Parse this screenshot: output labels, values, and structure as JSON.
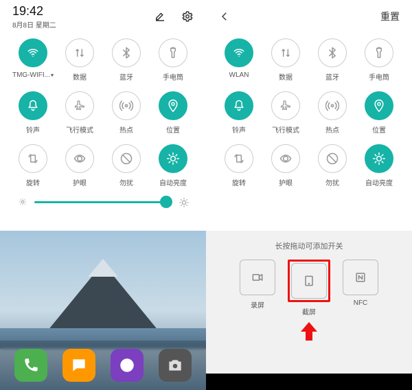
{
  "left": {
    "time": "19:42",
    "date": "8月8日 星期二",
    "tiles": [
      {
        "name": "wifi",
        "label": "TMG-WIFI...",
        "active": true,
        "caret": true
      },
      {
        "name": "data",
        "label": "数据",
        "active": false,
        "caret": false
      },
      {
        "name": "bluetooth",
        "label": "蓝牙",
        "active": false,
        "caret": false
      },
      {
        "name": "flashlight",
        "label": "手电筒",
        "active": false,
        "caret": false
      },
      {
        "name": "ring",
        "label": "铃声",
        "active": true,
        "caret": false
      },
      {
        "name": "airplane",
        "label": "飞行模式",
        "active": false,
        "caret": false
      },
      {
        "name": "hotspot",
        "label": "热点",
        "active": false,
        "caret": false
      },
      {
        "name": "location",
        "label": "位置",
        "active": true,
        "caret": false
      },
      {
        "name": "rotate",
        "label": "旋转",
        "active": false,
        "caret": false
      },
      {
        "name": "eyecare",
        "label": "护眼",
        "active": false,
        "caret": false
      },
      {
        "name": "dnd",
        "label": "勿扰",
        "active": false,
        "caret": false
      },
      {
        "name": "autobright",
        "label": "自动亮度",
        "active": true,
        "caret": false
      }
    ],
    "dock": [
      "phone",
      "msg",
      "browser",
      "camera"
    ]
  },
  "right": {
    "reset_label": "重置",
    "tiles": [
      {
        "name": "wifi",
        "label": "WLAN",
        "active": true
      },
      {
        "name": "data",
        "label": "数据",
        "active": false
      },
      {
        "name": "bluetooth",
        "label": "蓝牙",
        "active": false
      },
      {
        "name": "flashlight",
        "label": "手电筒",
        "active": false
      },
      {
        "name": "ring",
        "label": "铃声",
        "active": true
      },
      {
        "name": "airplane",
        "label": "飞行模式",
        "active": false
      },
      {
        "name": "hotspot",
        "label": "热点",
        "active": false
      },
      {
        "name": "location",
        "label": "位置",
        "active": true
      },
      {
        "name": "rotate",
        "label": "旋转",
        "active": false
      },
      {
        "name": "eyecare",
        "label": "护眼",
        "active": false
      },
      {
        "name": "dnd",
        "label": "勿扰",
        "active": false
      },
      {
        "name": "autobright",
        "label": "自动亮度",
        "active": true
      }
    ],
    "add_hint": "长按拖动可添加开关",
    "add_tiles": [
      {
        "name": "record",
        "label": "录屏",
        "highlight": false
      },
      {
        "name": "screenshot",
        "label": "截屏",
        "highlight": true
      },
      {
        "name": "nfc",
        "label": "NFC",
        "highlight": false
      }
    ]
  }
}
